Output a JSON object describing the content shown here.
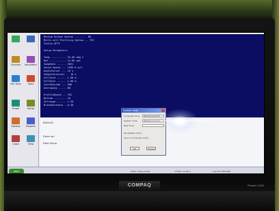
{
  "laptop": {
    "brand": "COMPAQ",
    "model": "Presario CQ40"
  },
  "leftbar": {
    "buttons": [
      {
        "label": "",
        "color": "#35a85a"
      },
      {
        "label": "",
        "color": "#3c69b8"
      },
      {
        "label": "Connect",
        "color": "#c28a1f"
      },
      {
        "label": "Send/Recv",
        "color": "#9a4cb2"
      },
      {
        "label": "Set Time",
        "color": "#2b7fd1"
      },
      {
        "label": "Start",
        "color": "#cf4a2d"
      },
      {
        "label": "Graph",
        "color": "#1c8f7c"
      },
      {
        "label": "Setup",
        "color": "#7b8b27"
      },
      {
        "label": "Options",
        "color": "#d06c2a"
      },
      {
        "label": "Reports",
        "color": "#4a5ccf"
      },
      {
        "label": "Close",
        "color": "#b23f3f"
      },
      {
        "label": "Help",
        "color": "#3f8fb2"
      }
    ]
  },
  "console": {
    "lines": [
      "Backup Output Option -------  NO",
      "Multi-cell Profiling Option -- YES",
      "Status OFFF",
      "",
      "Setup Parameters",
      "",
      "Temp ---------- 25.66 deg C",
      "Bat ----------- 13.66 ppt",
      "SampRate ------ 5HZ1  ",
      "Sound Speed --- 1503.0 m/s",
      "AvgInterval --- 10 s",
      "SampleInterval -  10 s",
      "CellSize ------ 1.00 m",
      "CellDist ------ 1.00 m",
      "CoordSystem --- ENU",
      "Averaging ----- NO",
      "",
      "ProfileDepth -- YES",
      "Bottom -------- 10",
      "Velrange ------ 1.50",
      "BlankDistance - 0.50"
    ]
  },
  "lower": {
    "lines": [
      "ENDLOG",
      "Done.ran",
      "Data Setup"
    ]
  },
  "dialog": {
    "title": "System Clock",
    "rows": [
      {
        "label": "Computer Time",
        "value": "2011-04-12 10:25"
      },
      {
        "label": "System Time",
        "value": "2011-04-12 10:25"
      },
      {
        "label": "New Time",
        "value": ""
      }
    ],
    "option_label": "Set System Clock",
    "option2_label": "Sync to Computer Clock",
    "ok_label": "OK",
    "cancel_label": "Cancel"
  },
  "taskbar": {
    "start_label": "start",
    "status": [
      "Mode: Deployment",
      "Int Bat: 13.66 V",
      "Log File: RECORD"
    ]
  }
}
